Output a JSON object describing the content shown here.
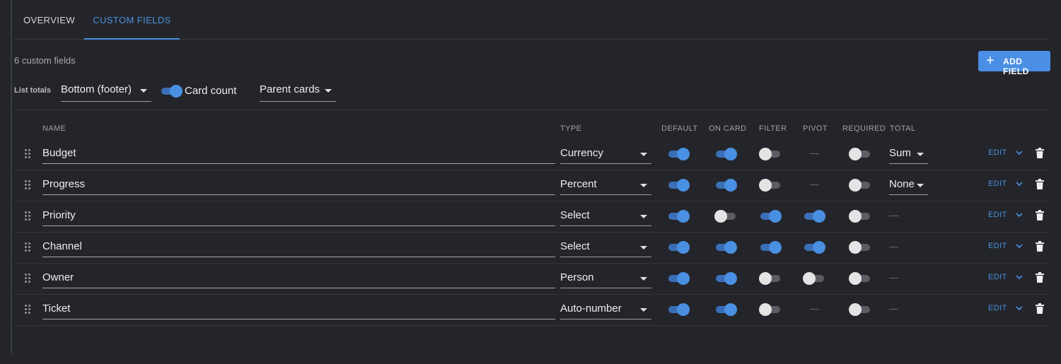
{
  "tabs": [
    {
      "label": "OVERVIEW",
      "active": false
    },
    {
      "label": "CUSTOM FIELDS",
      "active": true
    }
  ],
  "summary": {
    "count_text": "6 custom fields"
  },
  "toolbar": {
    "add_label": "ADD FIELD",
    "add_icon": "plus-icon"
  },
  "list_totals": {
    "label": "List totals",
    "position_value": "Bottom (footer)",
    "card_count_on": true,
    "card_count_label": "Card count",
    "scope_value": "Parent cards"
  },
  "columns": {
    "name": "NAME",
    "type": "TYPE",
    "default": "DEFAULT",
    "on_card": "ON CARD",
    "filter": "FILTER",
    "pivot": "PIVOT",
    "required": "REQUIRED",
    "total": "TOTAL"
  },
  "dash": "—",
  "edit_label": "EDIT",
  "accent_color": "#4a90e2",
  "fields": [
    {
      "name": "Budget",
      "type": "Currency",
      "default": true,
      "on_card": true,
      "filter": false,
      "pivot": null,
      "required": false,
      "total": "Sum"
    },
    {
      "name": "Progress",
      "type": "Percent",
      "default": true,
      "on_card": true,
      "filter": false,
      "pivot": null,
      "required": false,
      "total": "None"
    },
    {
      "name": "Priority",
      "type": "Select",
      "default": true,
      "on_card": false,
      "filter": true,
      "pivot": true,
      "required": false,
      "total": null
    },
    {
      "name": "Channel",
      "type": "Select",
      "default": true,
      "on_card": true,
      "filter": true,
      "pivot": true,
      "required": false,
      "total": null
    },
    {
      "name": "Owner",
      "type": "Person",
      "default": true,
      "on_card": true,
      "filter": false,
      "pivot": false,
      "required": false,
      "total": null
    },
    {
      "name": "Ticket",
      "type": "Auto-number",
      "default": true,
      "on_card": true,
      "filter": false,
      "pivot": null,
      "required": false,
      "total": null
    }
  ]
}
